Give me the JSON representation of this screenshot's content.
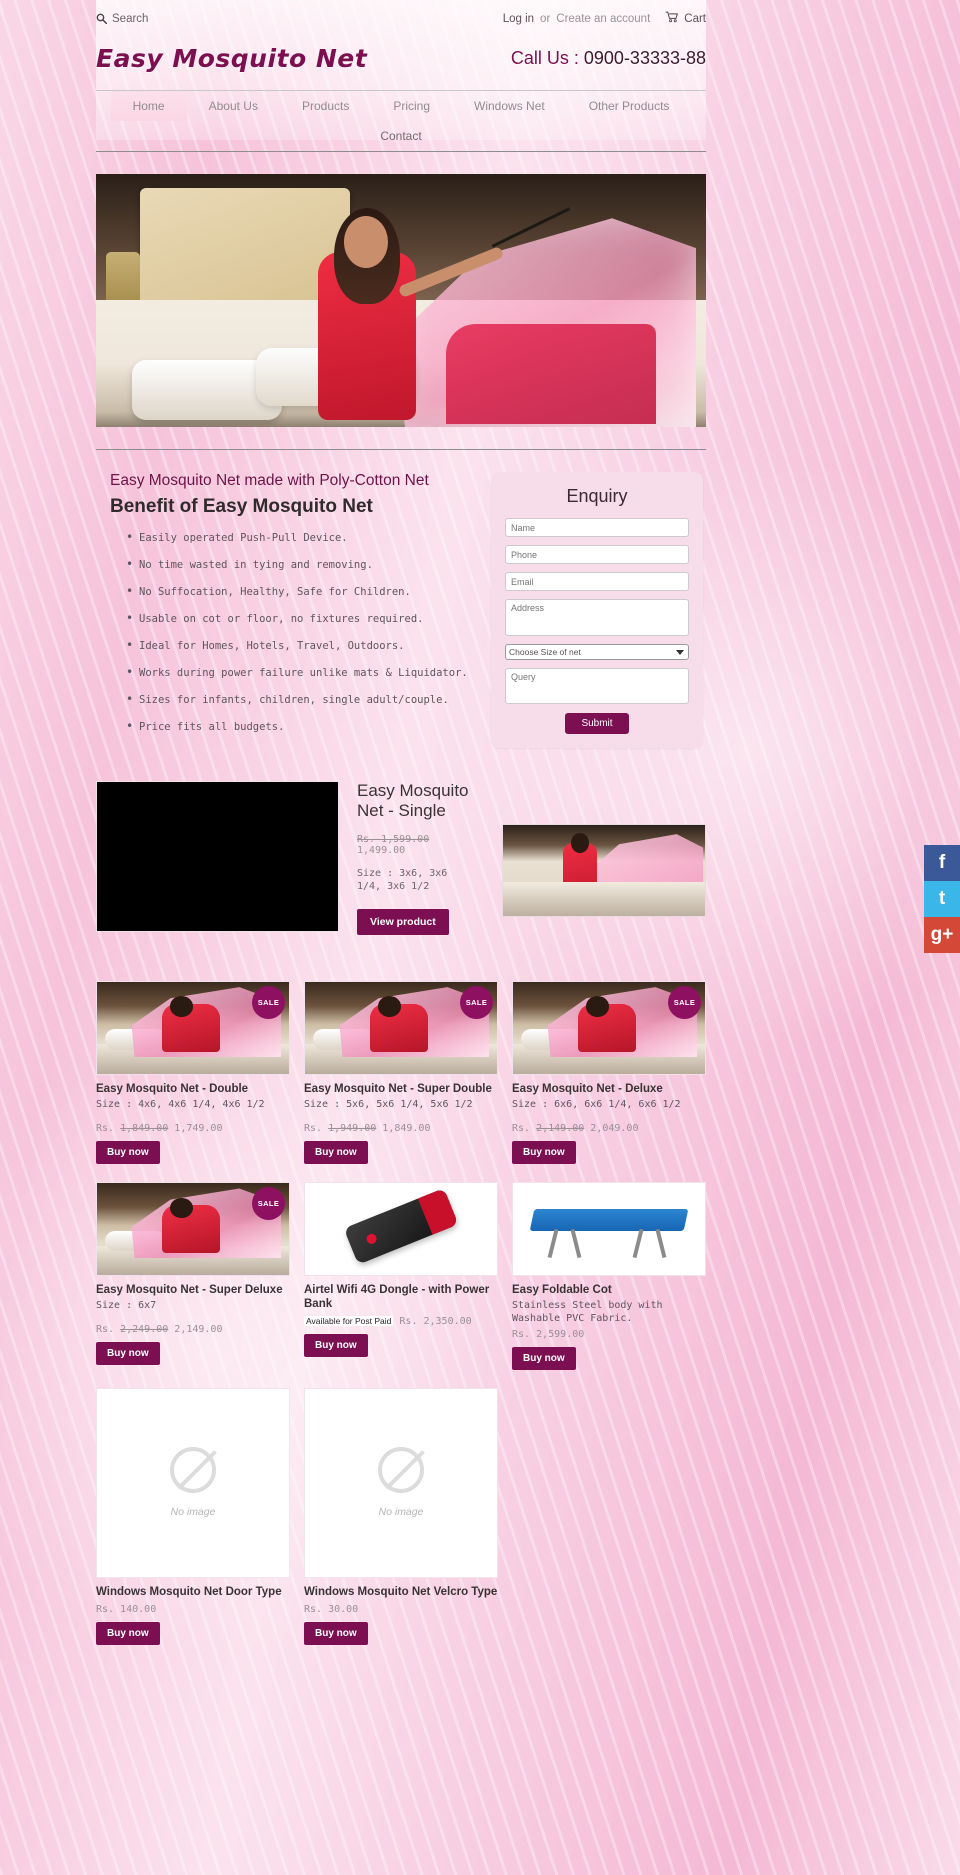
{
  "topbar": {
    "search_label": "Search",
    "search_icon": "search-icon",
    "login_label": "Log in",
    "or_label": "or",
    "create_account_label": "Create an account",
    "cart_label": "Cart",
    "cart_icon": "cart-icon"
  },
  "brand": {
    "logo": "Easy Mosquito Net",
    "call_label": "Call Us : ",
    "phone": "0900-33333-88"
  },
  "nav": {
    "items": [
      {
        "label": "Home",
        "active": true
      },
      {
        "label": "About Us",
        "active": false
      },
      {
        "label": "Products",
        "active": false
      },
      {
        "label": "Pricing",
        "active": false
      },
      {
        "label": "Windows Net",
        "active": false
      },
      {
        "label": "Other Products",
        "active": false
      },
      {
        "label": "Contact",
        "active": false
      }
    ]
  },
  "intro": {
    "subtitle": "Easy Mosquito Net made with Poly-Cotton Net",
    "heading": "Benefit of Easy Mosquito Net",
    "benefits": [
      "Easily operated Push-Pull Device.",
      "No time wasted in tying and removing.",
      "No Suffocation, Healthy, Safe for Children.",
      "Usable on cot or floor, no fixtures required.",
      "Ideal for Homes, Hotels, Travel, Outdoors.",
      "Works during power failure unlike mats & Liquidator.",
      "Sizes for infants, children, single adult/couple.",
      "Price fits all budgets."
    ]
  },
  "enquiry": {
    "title": "Enquiry",
    "name_placeholder": "Name",
    "phone_placeholder": "Phone",
    "email_placeholder": "Email",
    "address_placeholder": "Address",
    "size_selected": "Choose Size of net",
    "query_placeholder": "Query",
    "submit_label": "Submit"
  },
  "featured": {
    "title": "Easy Mosquito Net - Single",
    "price_old": "Rs. 1,599.00",
    "price_new": "1,499.00",
    "size": "Size : 3x6, 3x6 1/4, 3x6 1/2",
    "button_label": "View product"
  },
  "products": [
    {
      "name": "Easy Mosquito Net - Double",
      "size": "Size : 4x6, 4x6 1/4, 4x6 1/2",
      "price_prefix": "Rs.",
      "price_old": "1,849.00",
      "price_new": "1,749.00",
      "badge": "SALE",
      "button_label": "Buy now",
      "image": "mosquito-net-photo"
    },
    {
      "name": "Easy Mosquito Net - Super Double",
      "size": "Size :  5x6, 5x6 1/4, 5x6 1/2",
      "price_prefix": "Rs.",
      "price_old": "1,949.00",
      "price_new": "1,849.00",
      "badge": "SALE",
      "button_label": "Buy now",
      "image": "mosquito-net-photo"
    },
    {
      "name": "Easy Mosquito Net - Deluxe",
      "size": "Size : 6x6, 6x6 1/4, 6x6 1/2",
      "price_prefix": "Rs.",
      "price_old": "2,149.00",
      "price_new": "2,049.00",
      "badge": "SALE",
      "button_label": "Buy now",
      "image": "mosquito-net-photo"
    },
    {
      "name": "Easy Mosquito Net - Super Deluxe",
      "size": "Size : 6x7",
      "price_prefix": "Rs.",
      "price_old": "2,249.00",
      "price_new": "2,149.00",
      "badge": "SALE",
      "button_label": "Buy now",
      "image": "mosquito-net-photo"
    },
    {
      "name": "Airtel Wifi 4G Dongle - with Power Bank",
      "tag": "Available for Post Paid",
      "price_prefix": "Rs.",
      "price_new": "2,350.00",
      "button_label": "Buy now",
      "image": "dongle-photo"
    },
    {
      "name": "Easy Foldable Cot",
      "size": "Stainless Steel body with Washable PVC Fabric.",
      "price_prefix": "Rs.",
      "price_new": "2,599.00",
      "button_label": "Buy now",
      "image": "foldable-cot-photo"
    },
    {
      "name": "Windows Mosquito Net Door Type",
      "price_prefix": "Rs.",
      "price_new": "140.00",
      "button_label": "Buy now",
      "image": "no-image",
      "no_image_label": "No image"
    },
    {
      "name": "Windows Mosquito Net Velcro Type",
      "price_prefix": "Rs.",
      "price_new": "30.00",
      "button_label": "Buy now",
      "image": "no-image",
      "no_image_label": "No image"
    }
  ],
  "social": [
    {
      "name": "facebook",
      "glyph": "f",
      "color": "#3b5998"
    },
    {
      "name": "twitter",
      "glyph": "t",
      "color": "#3ab7e8"
    },
    {
      "name": "google-plus",
      "glyph": "g+",
      "color": "#d34836"
    }
  ]
}
